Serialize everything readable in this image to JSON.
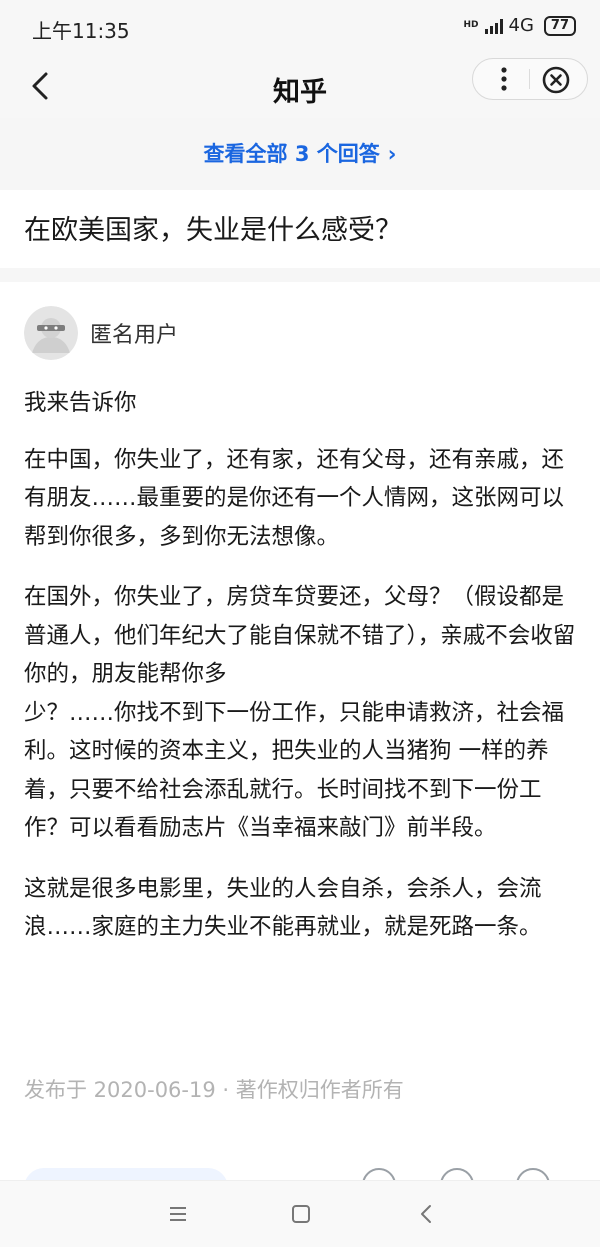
{
  "status_bar": {
    "time": "上午11:35",
    "hd_label": "HD",
    "network": "4G",
    "battery": "77"
  },
  "nav": {
    "title": "知乎"
  },
  "view_all": {
    "label": "查看全部 3 个回答",
    "chevron": "›"
  },
  "question": {
    "title": "在欧美国家，失业是什么感受？"
  },
  "author": {
    "name": "匿名用户"
  },
  "answer": {
    "paragraphs": [
      "我来告诉你",
      "在中国，你失业了，还有家，还有父母，还有亲戚，还有朋友……最重要的是你还有一个人情网，这张网可以帮到你很多，多到你无法想像。",
      "在国外，你失业了，房贷车贷要还，父母？（假设都是普通人，他们年纪大了能自保就不错了），亲戚不会收留你的，朋友能帮你多\n少？……你找不到下一份工作，只能申请救济，社会福利。这时候的资本主义，把失业的人当猪狗 一样的养着，只要不给社会添乱就行。长时间找不到下一份工作？可以看看励志片《当幸福来敲门》前半段。",
      "这就是很多电影里，失业的人会自杀，会杀人，会流浪……家庭的主力失业不能再就业，就是死路一条。"
    ],
    "meta": "发布于 2020-06-19 · 著作权归作者所有"
  },
  "colors": {
    "accent": "#1a66e0",
    "meta_text": "#b3b3b3",
    "background_gray": "#f6f6f6"
  }
}
